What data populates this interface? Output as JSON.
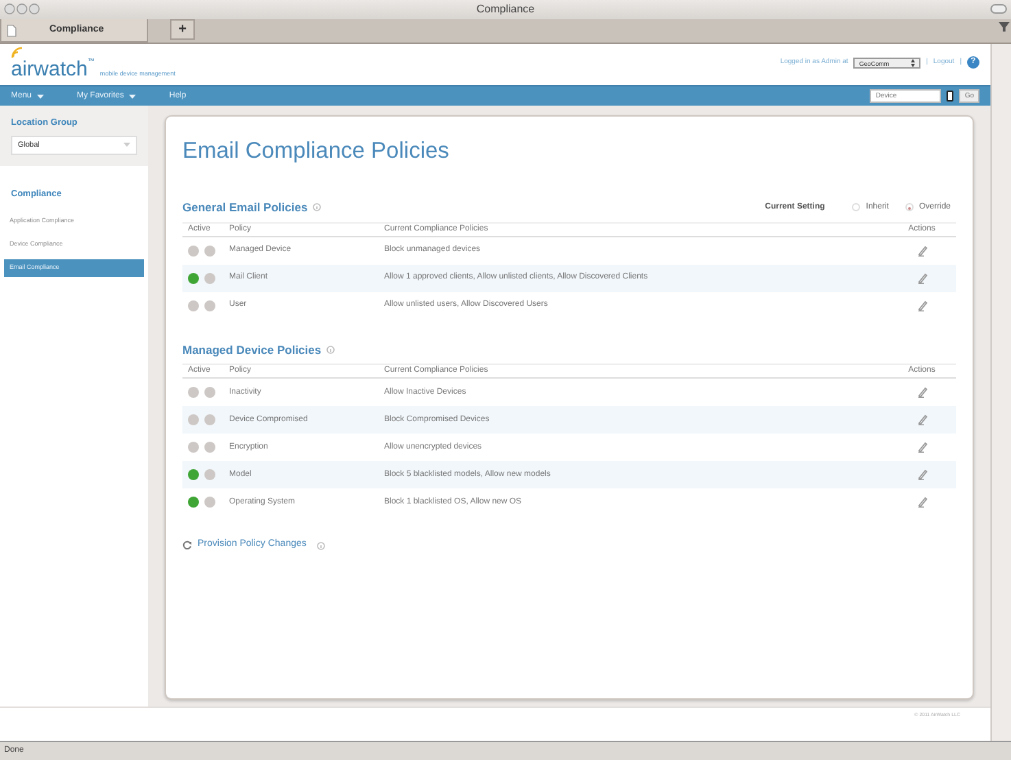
{
  "window": {
    "title": "Compliance"
  },
  "tabs": [
    {
      "label": "Compliance",
      "selected": true
    }
  ],
  "new_tab_button": "+",
  "header": {
    "logo": "airwatch",
    "logo_mark": "™",
    "tagline": "mobile device management",
    "login_text": "Logged in as Admin at",
    "org_select": "GeoComm",
    "separator": "|",
    "logout": "Logout",
    "help": "?"
  },
  "nav": {
    "menus": [
      {
        "label": "Menu",
        "dropdown": true
      },
      {
        "label": "My Favorites",
        "dropdown": true
      },
      {
        "label": "Help",
        "dropdown": false
      }
    ],
    "search": {
      "placeholder": "Device"
    },
    "go_button": "Go"
  },
  "sidebar": {
    "location_group_label": "Location Group",
    "location_group_value": "Global",
    "section": "Compliance",
    "items": [
      {
        "label": "Application Compliance",
        "selected": false
      },
      {
        "label": "Device Compliance",
        "selected": false
      },
      {
        "label": "Email Compliance",
        "selected": true
      }
    ]
  },
  "main": {
    "title": "Email Compliance Policies",
    "current_setting": {
      "label": "Current Setting",
      "options": [
        {
          "label": "Inherit",
          "selected": false
        },
        {
          "label": "Override",
          "selected": true
        }
      ]
    },
    "sections": [
      {
        "title": "General Email Policies",
        "columns": [
          "Active",
          "Policy",
          "Current Compliance Policies",
          "Actions"
        ],
        "rows": [
          {
            "active": false,
            "policy": "Managed Device",
            "current": "Block unmanaged devices"
          },
          {
            "active": true,
            "policy": "Mail Client",
            "current": "Allow 1 approved clients, Allow unlisted clients, Allow Discovered Clients"
          },
          {
            "active": false,
            "policy": "User",
            "current": "Allow unlisted users, Allow Discovered Users"
          }
        ]
      },
      {
        "title": "Managed Device Policies",
        "columns": [
          "Active",
          "Policy",
          "Current Compliance Policies",
          "Actions"
        ],
        "rows": [
          {
            "active": false,
            "policy": "Inactivity",
            "current": "Allow Inactive Devices"
          },
          {
            "active": false,
            "policy": "Device Compromised",
            "current": "Block Compromised Devices"
          },
          {
            "active": false,
            "policy": "Encryption",
            "current": "Allow unencrypted devices"
          },
          {
            "active": true,
            "policy": "Model",
            "current": "Block 5 blacklisted models, Allow new models"
          },
          {
            "active": true,
            "policy": "Operating System",
            "current": "Block 1 blacklisted OS, Allow new OS"
          }
        ]
      }
    ],
    "provision_link": "Provision Policy Changes"
  },
  "footer": {
    "copyright": "© 2011 AirWatch LLC"
  },
  "status_bar": "Done"
}
